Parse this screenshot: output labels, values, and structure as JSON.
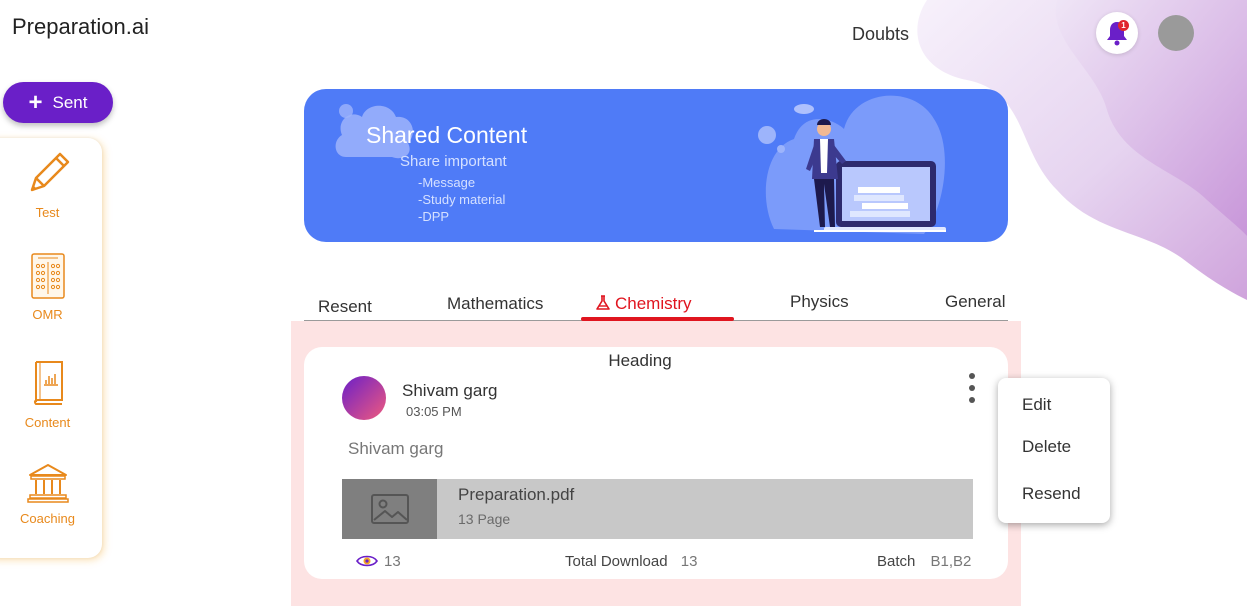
{
  "app": {
    "logo_text": "Preparation.ai"
  },
  "header": {
    "doubts_label": "Doubts",
    "notification_count": "1"
  },
  "compose": {
    "sent_label": "Sent"
  },
  "sidebar": {
    "items": [
      {
        "label": "Test",
        "icon": "pencil-icon"
      },
      {
        "label": "OMR",
        "icon": "omr-sheet-icon"
      },
      {
        "label": "Content",
        "icon": "book-icon"
      },
      {
        "label": "Coaching",
        "icon": "institution-icon"
      }
    ]
  },
  "banner": {
    "title": "Shared Content",
    "subtitle": "Share important",
    "lines": [
      "-Message",
      "-Study material",
      "-DPP"
    ]
  },
  "tabs": [
    {
      "label": "Resent"
    },
    {
      "label": "Mathematics"
    },
    {
      "label": "Chemistry",
      "active": true
    },
    {
      "label": "Physics"
    },
    {
      "label": "General"
    }
  ],
  "post": {
    "heading": "Heading",
    "author": "Shivam garg",
    "time": "03:05 PM",
    "message": "Shivam garg",
    "file": {
      "name": "Preparation.pdf",
      "pages": "13 Page"
    },
    "views": "13",
    "total_download_label": "Total Download",
    "total_download_value": "13",
    "batch_label": "Batch",
    "batch_value": "B1,B2"
  },
  "context_menu": {
    "items": [
      "Edit",
      "Delete",
      "Resend"
    ]
  },
  "colors": {
    "primary_purple": "#6a1fc8",
    "banner_blue": "#4f7bf7",
    "active_tab_red": "#e0151f",
    "sidebar_orange": "#e8891c",
    "content_bg_pink": "#fde3e3"
  }
}
